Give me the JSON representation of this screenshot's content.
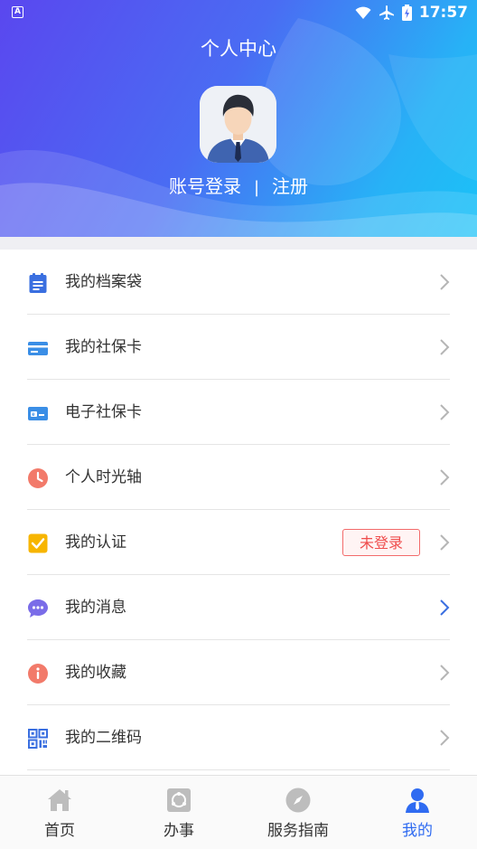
{
  "status_bar": {
    "time": "17:57"
  },
  "header": {
    "title": "个人中心",
    "login_label": "账号登录",
    "separator": "|",
    "register_label": "注册"
  },
  "menu": {
    "items": [
      {
        "label": "我的档案袋",
        "icon": "clipboard-icon"
      },
      {
        "label": "我的社保卡",
        "icon": "card-icon"
      },
      {
        "label": "电子社保卡",
        "icon": "e-card-icon"
      },
      {
        "label": "个人时光轴",
        "icon": "clock-icon"
      },
      {
        "label": "我的认证",
        "icon": "check-square-icon",
        "badge": "未登录"
      },
      {
        "label": "我的消息",
        "icon": "chat-bubble-icon"
      },
      {
        "label": "我的收藏",
        "icon": "info-icon"
      },
      {
        "label": "我的二维码",
        "icon": "qr-code-icon"
      }
    ]
  },
  "tab_bar": {
    "tabs": [
      {
        "label": "首页",
        "icon": "home-icon"
      },
      {
        "label": "办事",
        "icon": "services-icon"
      },
      {
        "label": "服务指南",
        "icon": "compass-icon"
      },
      {
        "label": "我的",
        "icon": "user-icon",
        "active": true
      }
    ]
  },
  "colors": {
    "accent": "#2f6bf1",
    "badge_red": "#ef4c4c",
    "header_start": "#5a47ef",
    "header_end": "#1bc2f7"
  }
}
